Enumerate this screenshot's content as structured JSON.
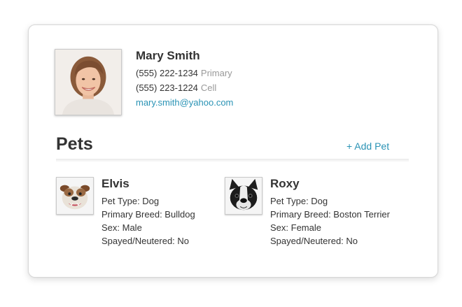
{
  "owner": {
    "name": "Mary Smith",
    "phones": [
      {
        "number": "(555) 222-1234",
        "type": "Primary"
      },
      {
        "number": "(555) 223-1224",
        "type": "Cell"
      }
    ],
    "email": "mary.smith@yahoo.com"
  },
  "pets_section": {
    "heading": "Pets",
    "add_label": "+ Add Pet"
  },
  "pets": [
    {
      "name": "Elvis",
      "type": "Pet Type: Dog",
      "breed": "Primary Breed: Bulldog",
      "sex": "Sex: Male",
      "spayed": "Spayed/Neutered: No"
    },
    {
      "name": "Roxy",
      "type": "Pet Type: Dog",
      "breed": "Primary Breed: Boston Terrier",
      "sex": "Sex: Female",
      "spayed": "Spayed/Neutered: No"
    }
  ],
  "colors": {
    "link": "#2a93b5",
    "text": "#333333",
    "muted": "#999999"
  }
}
